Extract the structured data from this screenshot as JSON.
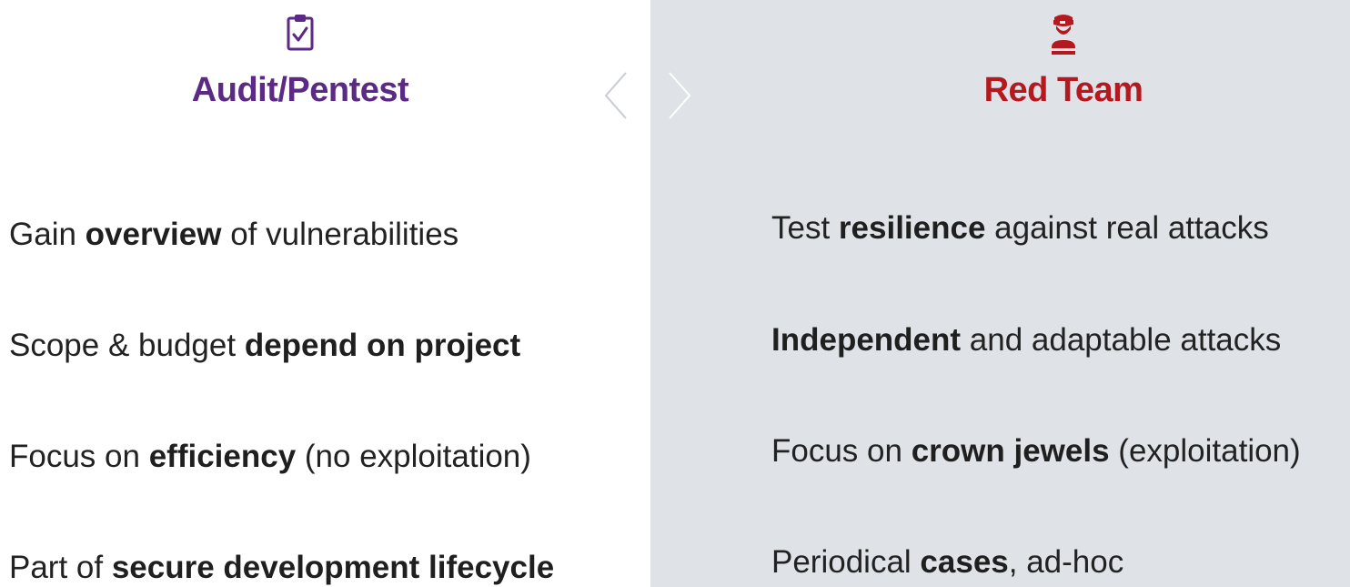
{
  "left": {
    "icon": "clipboard-check-icon",
    "title": "Audit/Pentest",
    "title_color": "#5b2a84",
    "items": [
      {
        "pre": "Gain ",
        "bold": "overview",
        "post": " of vulnerabilities"
      },
      {
        "pre": "Scope & budget ",
        "bold": "depend on project",
        "post": ""
      },
      {
        "pre": "Focus on ",
        "bold": "efficiency",
        "post": " (no exploitation)"
      },
      {
        "pre": "Part of ",
        "bold": "secure development lifecycle",
        "post": ""
      }
    ]
  },
  "right": {
    "icon": "masked-attacker-icon",
    "title": "Red Team",
    "title_color": "#b3191e",
    "items": [
      {
        "pre": "Test ",
        "bold": "resilience",
        "post": " against real attacks"
      },
      {
        "pre": "",
        "bold": "Independent",
        "post": " and adaptable attacks"
      },
      {
        "pre": "Focus on ",
        "bold": "crown jewels",
        "post": " (exploitation)"
      },
      {
        "pre": "Periodical ",
        "bold": "cases",
        "post": ", ad-hoc"
      }
    ]
  },
  "nav": {
    "prev_icon": "chevron-left-icon",
    "next_icon": "chevron-right-icon"
  }
}
